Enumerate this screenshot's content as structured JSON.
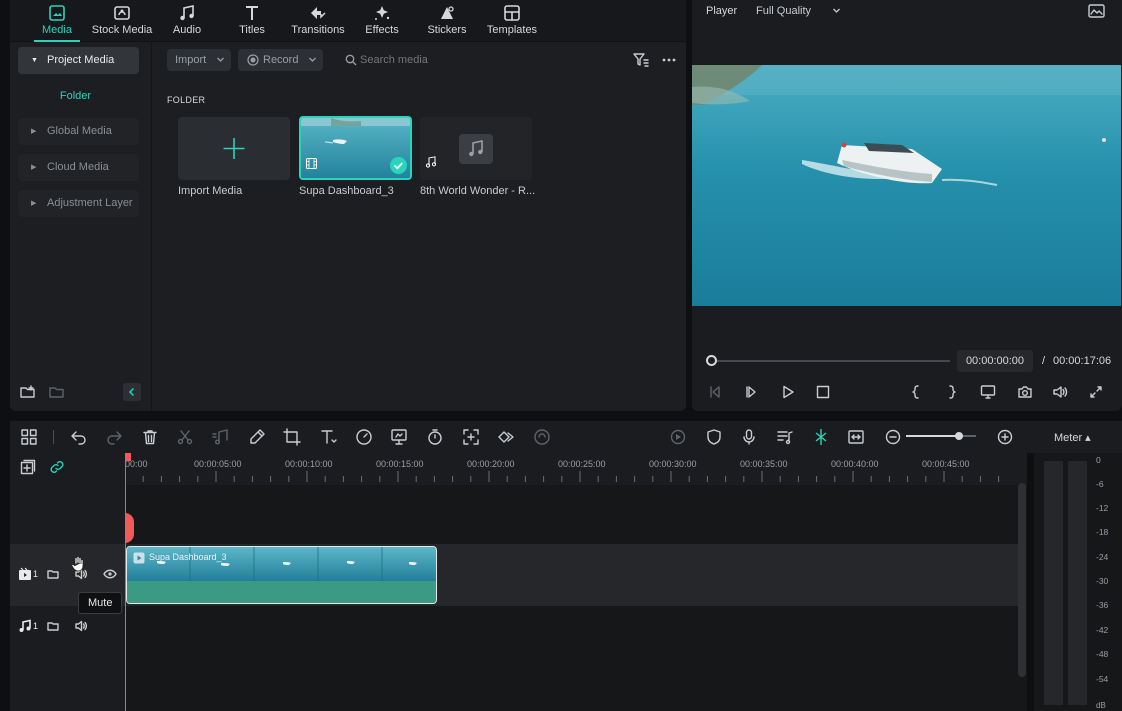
{
  "nav": {
    "tabs": [
      {
        "label": "Media",
        "icon": "media-icon",
        "active": true
      },
      {
        "label": "Stock Media",
        "icon": "stock-media-icon"
      },
      {
        "label": "Audio",
        "icon": "audio-icon"
      },
      {
        "label": "Titles",
        "icon": "titles-icon"
      },
      {
        "label": "Transitions",
        "icon": "transitions-icon"
      },
      {
        "label": "Effects",
        "icon": "effects-icon"
      },
      {
        "label": "Stickers",
        "icon": "stickers-icon"
      },
      {
        "label": "Templates",
        "icon": "templates-icon"
      }
    ]
  },
  "sidebar": {
    "project_media": "Project Media",
    "folder": "Folder",
    "global_media": "Global Media",
    "cloud_media": "Cloud Media",
    "adjustment_layer": "Adjustment Layer"
  },
  "media_toolbar": {
    "import_label": "Import",
    "record_label": "Record",
    "search_placeholder": "Search media"
  },
  "media": {
    "folder_heading": "FOLDER",
    "items": [
      {
        "label": "Import Media"
      },
      {
        "label": "Supa Dashboard_3",
        "selected": true
      },
      {
        "label": "8th World Wonder - R..."
      }
    ]
  },
  "player": {
    "label": "Player",
    "quality": "Full Quality",
    "current_time": "00:00:00:00",
    "separator": "/",
    "total_time": "00:00:17:06",
    "progress": 0
  },
  "timeline": {
    "ruler": [
      "00:00",
      "00:00:05:00",
      "00:00:10:00",
      "00:00:15:00",
      "00:00:20:00",
      "00:00:25:00",
      "00:00:30:00",
      "00:00:35:00",
      "00:00:40:00",
      "00:00:45:00"
    ],
    "video_track_num": "1",
    "audio_track_num": "1",
    "clip_title": "Supa Dashboard_3",
    "tooltip": "Mute",
    "zoom": 0.75
  },
  "meter": {
    "label": "Meter ▴",
    "scale": [
      "0",
      "-6",
      "-12",
      "-18",
      "-24",
      "-30",
      "-36",
      "-42",
      "-48",
      "-54"
    ],
    "unit": "dB"
  },
  "colors": {
    "accent": "#28d4bb",
    "playhead": "#ef5b5b",
    "clip": "#3b9a83"
  }
}
